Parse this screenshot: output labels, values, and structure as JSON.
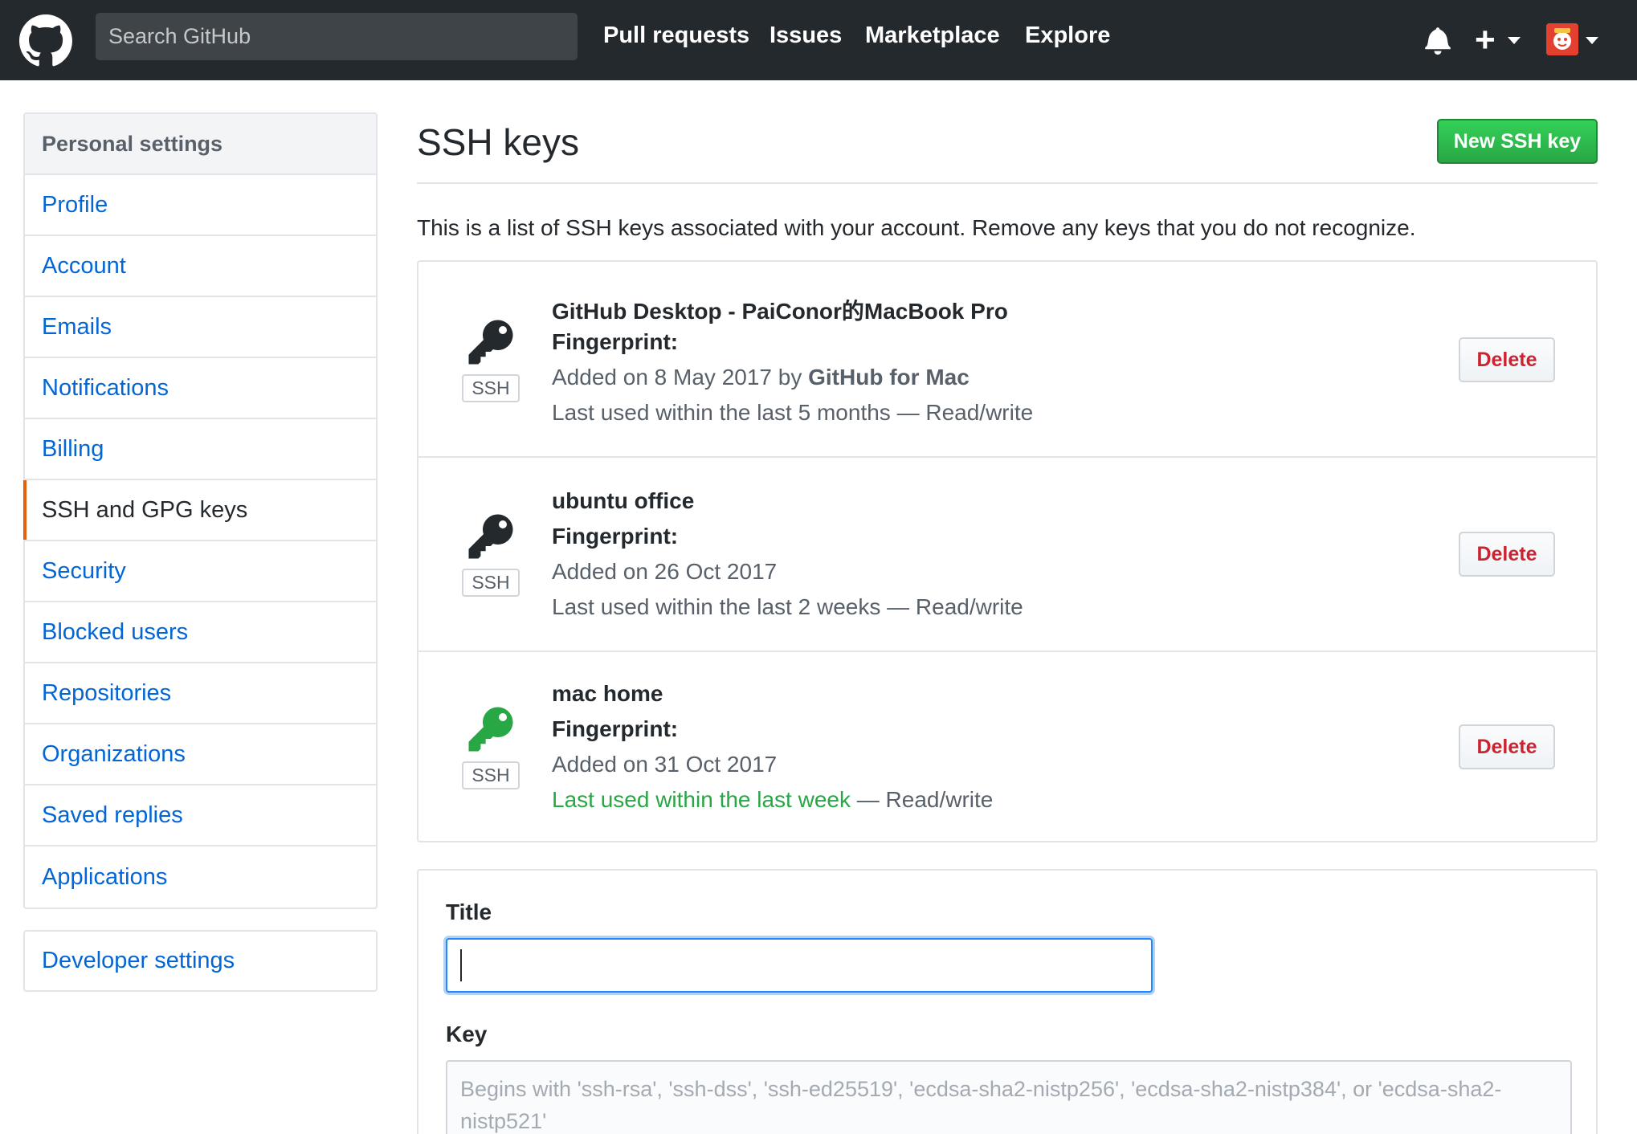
{
  "header": {
    "search_placeholder": "Search GitHub",
    "nav": [
      "Pull requests",
      "Issues",
      "Marketplace",
      "Explore"
    ],
    "icons": [
      "github-logo-icon",
      "bell-icon",
      "plus-icon",
      "avatar"
    ]
  },
  "sidebar": {
    "heading": "Personal settings",
    "items": [
      {
        "label": "Profile"
      },
      {
        "label": "Account"
      },
      {
        "label": "Emails"
      },
      {
        "label": "Notifications"
      },
      {
        "label": "Billing"
      },
      {
        "label": "SSH and GPG keys",
        "selected": true
      },
      {
        "label": "Security"
      },
      {
        "label": "Blocked users"
      },
      {
        "label": "Repositories"
      },
      {
        "label": "Organizations"
      },
      {
        "label": "Saved replies"
      },
      {
        "label": "Applications"
      }
    ],
    "developer_settings": "Developer settings"
  },
  "main": {
    "title": "SSH keys",
    "new_key_button": "New SSH key",
    "intro": "This is a list of SSH keys associated with your account. Remove any keys that you do not recognize.",
    "keys": [
      {
        "title": "GitHub Desktop - PaiConor的MacBook Pro",
        "fingerprint_label": "Fingerprint:",
        "added_prefix": "Added on 8 May 2017 by ",
        "added_by": "GitHub for Mac",
        "last_used": "Last used within the last 5 months",
        "access": " — Read/write",
        "badge": "SSH",
        "delete": "Delete",
        "recent": false
      },
      {
        "title": "ubuntu office",
        "fingerprint_label": "Fingerprint:",
        "added_prefix": "Added on 26 Oct 2017",
        "added_by": "",
        "last_used": "Last used within the last 2 weeks",
        "access": " — Read/write",
        "badge": "SSH",
        "delete": "Delete",
        "recent": false
      },
      {
        "title": "mac home",
        "fingerprint_label": "Fingerprint:",
        "added_prefix": "Added on 31 Oct 2017",
        "added_by": "",
        "last_used": "Last used within the last week",
        "access": " — Read/write",
        "badge": "SSH",
        "delete": "Delete",
        "recent": true
      }
    ],
    "form": {
      "title_label": "Title",
      "title_value": "",
      "key_label": "Key",
      "key_placeholder": "Begins with 'ssh-rsa', 'ssh-dss', 'ssh-ed25519', 'ecdsa-sha2-nistp256', 'ecdsa-sha2-nistp384', or 'ecdsa-sha2-nistp521'"
    }
  },
  "colors": {
    "header_bg": "#24292e",
    "link": "#0366d6",
    "green": "#28a745",
    "danger": "#cb2431",
    "selected_accent": "#e36209"
  }
}
